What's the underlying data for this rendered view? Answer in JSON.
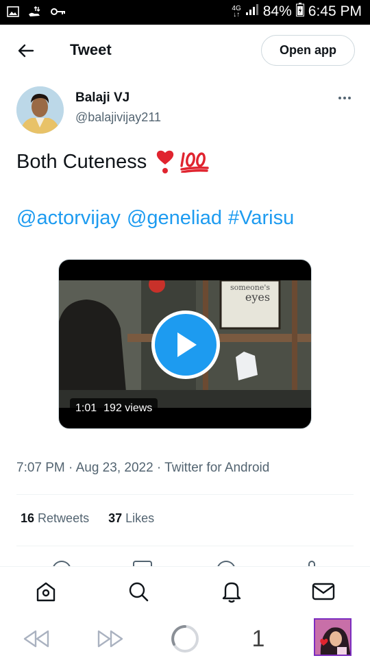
{
  "status_bar": {
    "network": "4G",
    "battery": "84%",
    "time": "6:45 PM"
  },
  "header": {
    "title": "Tweet",
    "open_app_label": "Open app"
  },
  "author": {
    "name": "Balaji VJ",
    "handle": "@balajivijay211"
  },
  "tweet": {
    "text": "Both Cuteness",
    "emojis": [
      "heavy-heart-exclamation",
      "hundred-points"
    ],
    "mentions": [
      "@actorvijay",
      "@geneliad",
      "#Varisu"
    ]
  },
  "video": {
    "duration": "1:01",
    "views": "192 views",
    "sign_text_1": "someone's",
    "sign_text_2": "eyes"
  },
  "meta": {
    "timestamp": "7:07 PM · Aug 23, 2022 · Twitter for Android"
  },
  "stats": {
    "retweets_count": "16",
    "retweets_label": "Retweets",
    "likes_count": "37",
    "likes_label": "Likes"
  },
  "bottom_nav": [
    "home-icon",
    "search-icon",
    "notifications-icon",
    "messages-icon"
  ],
  "browser_bar": {
    "tab_count": "1"
  },
  "colors": {
    "accent": "#1d9bf0",
    "secondary_text": "#536471",
    "primary_text": "#0f1419",
    "emoji_heart": "#e0242f",
    "emoji_hundred": "#e0242f"
  }
}
